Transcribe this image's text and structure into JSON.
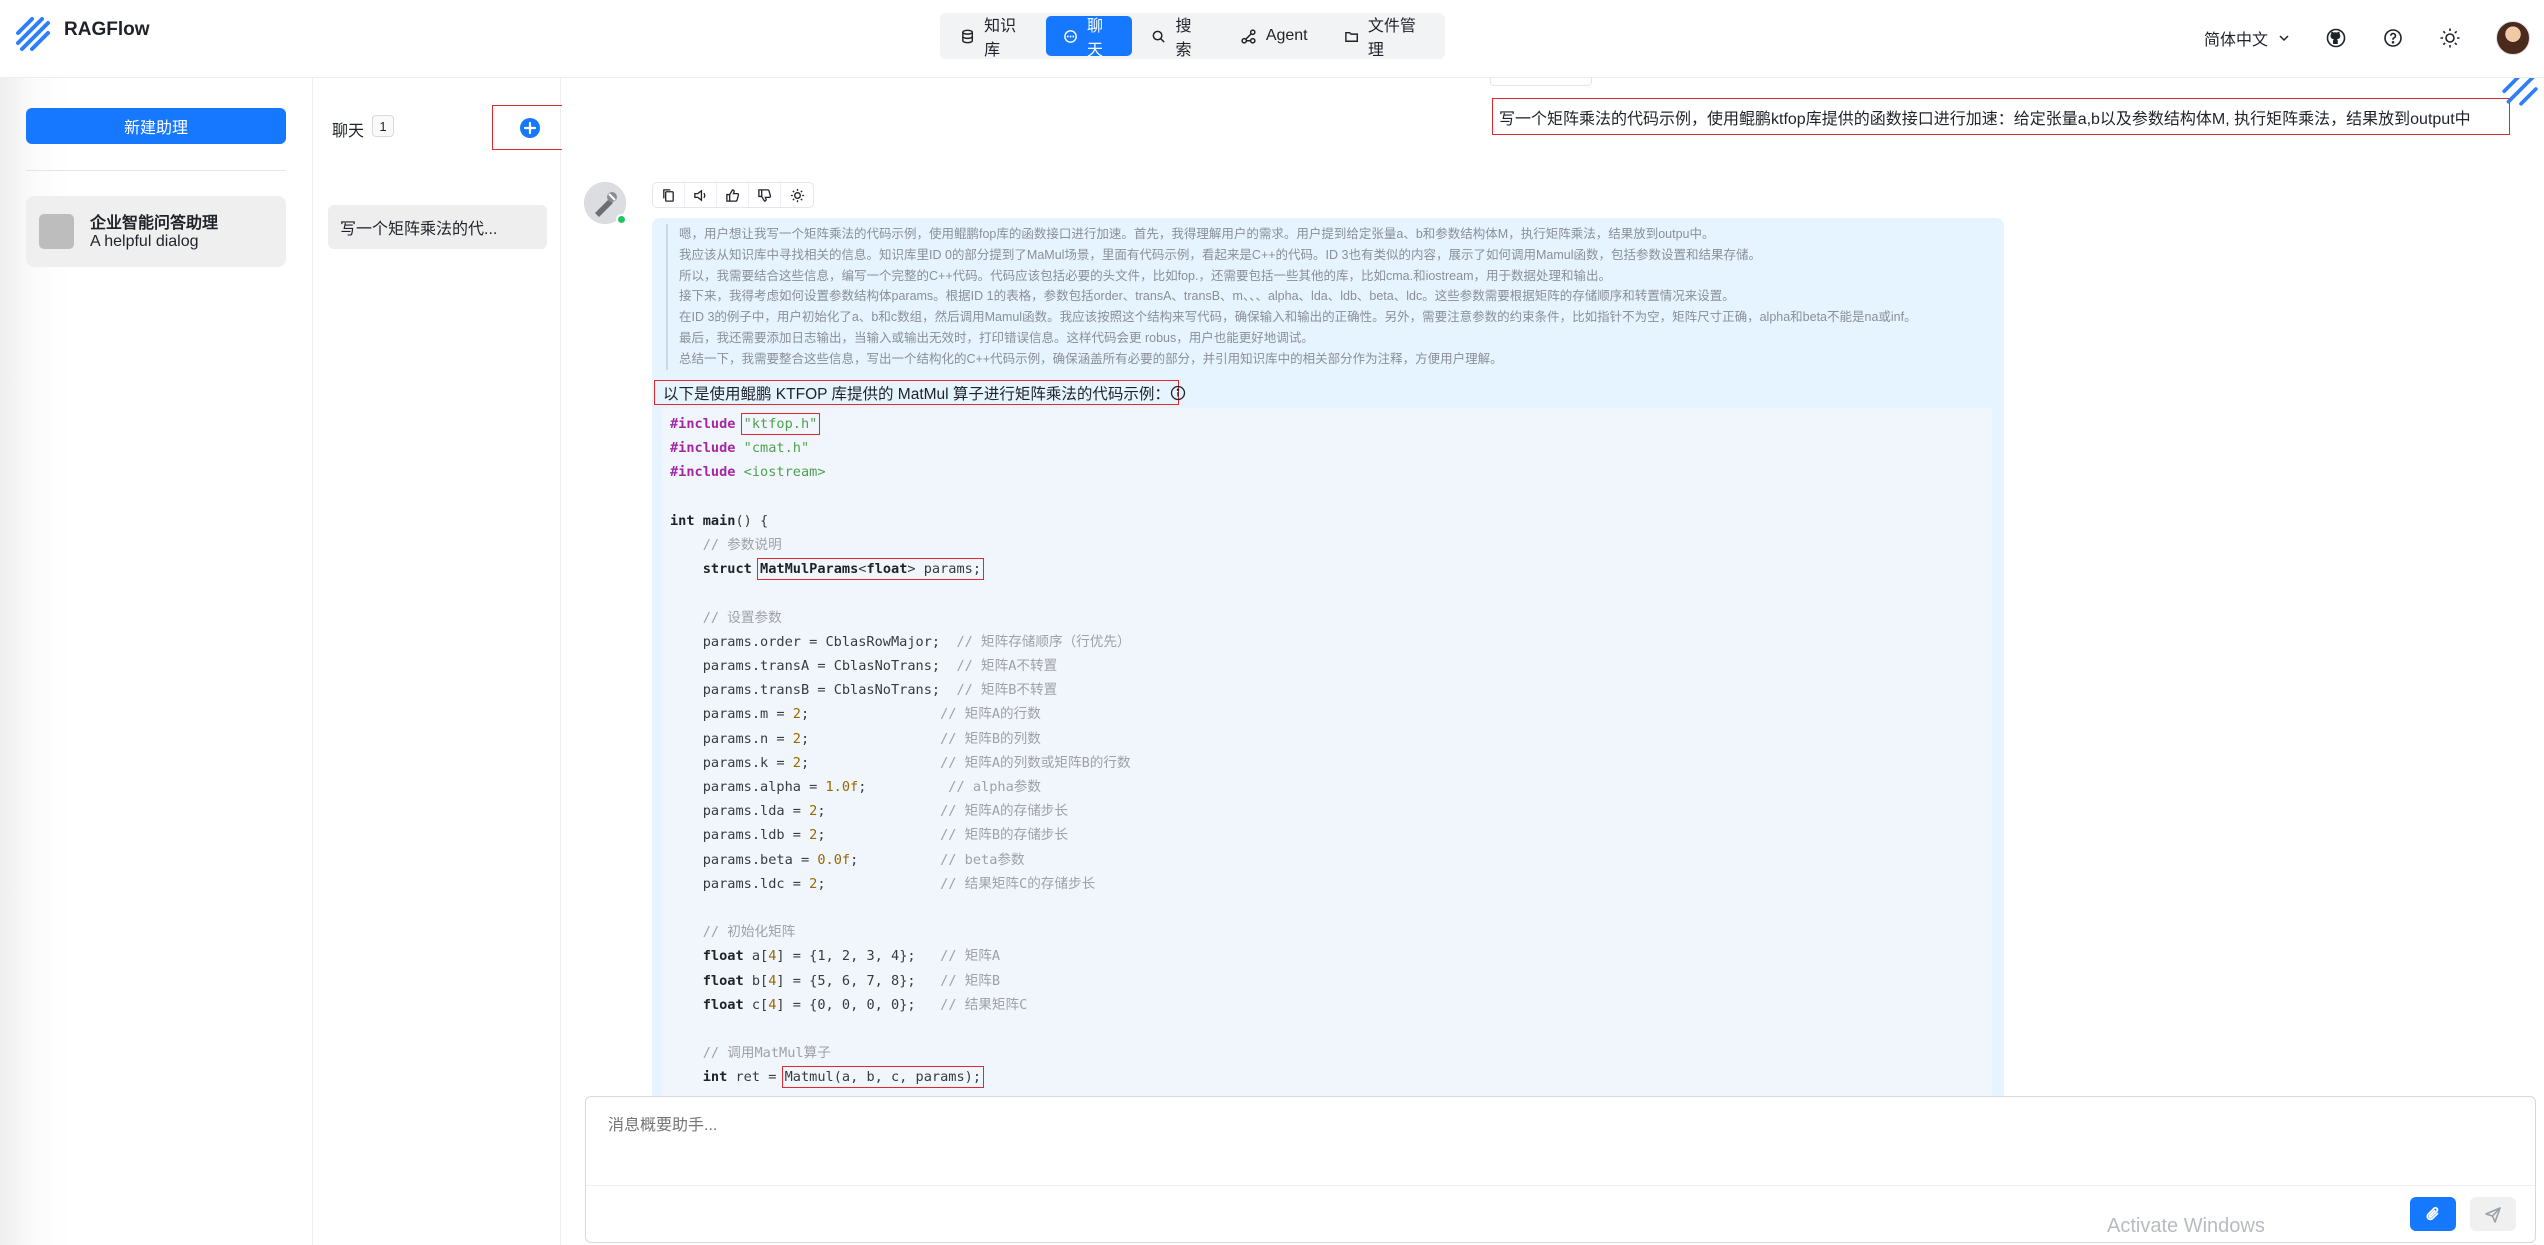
{
  "app": {
    "brand": "RAGFlow"
  },
  "nav": {
    "items": [
      {
        "label": "知识库",
        "icon": "database-icon",
        "active": false
      },
      {
        "label": "聊天",
        "icon": "chat-icon",
        "active": true
      },
      {
        "label": "搜索",
        "icon": "search-icon",
        "active": false
      },
      {
        "label": "Agent",
        "icon": "agent-icon",
        "active": false
      },
      {
        "label": "文件管理",
        "icon": "folder-icon",
        "active": false
      }
    ]
  },
  "topright": {
    "language": "简体中文"
  },
  "sidebar": {
    "new_assistant_label": "新建助理",
    "assistants": [
      {
        "name": "企业智能问答助理",
        "description": "A helpful dialog"
      }
    ]
  },
  "conversations": {
    "title": "聊天",
    "count": "1",
    "items": [
      {
        "title": "写一个矩阵乘法的代..."
      }
    ]
  },
  "chat": {
    "user_message": "写一个矩阵乘法的代码示例，使用鲲鹏ktfop库提供的函数接口进行加速：给定张量a,b以及参数结构体M, 执行矩阵乘法，结果放到output中",
    "thinking": [
      "嗯，用户想让我写一个矩阵乘法的代码示例，使用鲲鹏fop库的函数接口进行加速。首先，我得理解用户的需求。用户提到给定张量a、b和参数结构体M，执行矩阵乘法，结果放到outpu中。",
      "我应该从知识库中寻找相关的信息。知识库里ID 0的部分提到了MaMul场景，里面有代码示例，看起来是C++的代码。ID 3也有类似的内容，展示了如何调用Mamul函数，包括参数设置和结果存储。",
      "所以，我需要结合这些信息，编写一个完整的C++代码。代码应该包括必要的头文件，比如fop.，还需要包括一些其他的库，比如cma.和iostream，用于数据处理和输出。",
      "接下来，我得考虑如何设置参数结构体params。根据ID 1的表格，参数包括order、transA、transB、m、、、alpha、lda、ldb、beta、ldc。这些参数需要根据矩阵的存储顺序和转置情况来设置。",
      "在ID 3的例子中，用户初始化了a、b和c数组，然后调用Mamul函数。我应该按照这个结构来写代码，确保输入和输出的正确性。另外，需要注意参数的约束条件，比如指针不为空，矩阵尺寸正确，alpha和beta不能是na或inf。",
      "最后，我还需要添加日志输出，当输入或输出无效时，打印错误信息。这样代码会更 robus，用户也能更好地调试。",
      "总结一下，我需要整合这些信息，写出一个结构化的C++代码示例，确保涵盖所有必要的部分，并引用知识库中的相关部分作为注释，方便用户理解。"
    ],
    "intro": "以下是使用鲲鹏 KTFOP 库提供的 MatMul 算子进行矩阵乘法的代码示例：",
    "code": {
      "include1": "\"ktfop.h\"",
      "include2": "\"cmat.h\"",
      "include3": "<iostream>",
      "c_param_desc": "// 参数说明",
      "params_type": "MatMulParams",
      "c_set_params": "// 设置参数",
      "order_val": "CblasRowMajor",
      "c_order": "// 矩阵存储顺序（行优先）",
      "transA_val": "CblasNoTrans",
      "c_transA": "// 矩阵A不转置",
      "transB_val": "CblasNoTrans",
      "c_transB": "// 矩阵B不转置",
      "m_val": "2",
      "c_m": "// 矩阵A的行数",
      "n_val": "2",
      "c_n": "// 矩阵B的列数",
      "k_val": "2",
      "c_k": "// 矩阵A的列数或矩阵B的行数",
      "alpha_val": "1.0f",
      "c_alpha": "// alpha参数",
      "lda_val": "2",
      "c_lda": "// 矩阵A的存储步长",
      "ldb_val": "2",
      "c_ldb": "// 矩阵B的存储步长",
      "beta_val": "0.0f",
      "c_beta": "// beta参数",
      "ldc_val": "2",
      "c_ldc": "// 结果矩阵C的存储步长",
      "c_init": "// 初始化矩阵",
      "a_init": "{1, 2, 3, 4}",
      "c_a": "// 矩阵A",
      "b_init": "{5, 6, 7, 8}",
      "c_b": "// 矩阵B",
      "c_init_val": "{0, 0, 0, 0}",
      "c_c": "// 结果矩阵C",
      "c_call": "// 调用MatMul算子",
      "call": "Matmul(a, b, c, params);"
    }
  },
  "composer": {
    "placeholder": "消息概要助手..."
  },
  "watermark": "Activate Windows",
  "colors": {
    "primary": "#1677ff",
    "highlight_border": "#e0282e",
    "bubble": "#e6f4ff"
  }
}
